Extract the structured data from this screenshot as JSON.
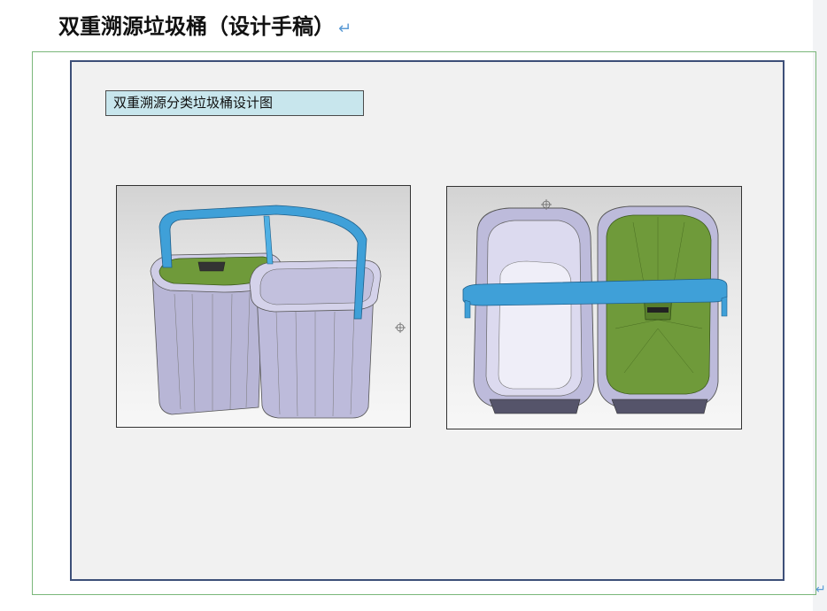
{
  "document": {
    "title": "双重溯源垃圾桶（设计手稿）",
    "paragraph_mark": "↵",
    "figure": {
      "caption": "双重溯源分类垃圾桶设计图",
      "renders": [
        {
          "view": "perspective",
          "description_icon": "dual-trash-bin-perspective-render"
        },
        {
          "view": "top",
          "description_icon": "dual-trash-bin-top-render"
        }
      ]
    }
  },
  "colors": {
    "bin_body": "#b8b6d6",
    "bin_lid": "#6f9a3a",
    "handle": "#3fa0d8",
    "panel_border": "#3d4f78",
    "frame_border": "#7ab77a",
    "caption_bg": "#c8e6ed",
    "para_mark": "#5b9bd5"
  }
}
